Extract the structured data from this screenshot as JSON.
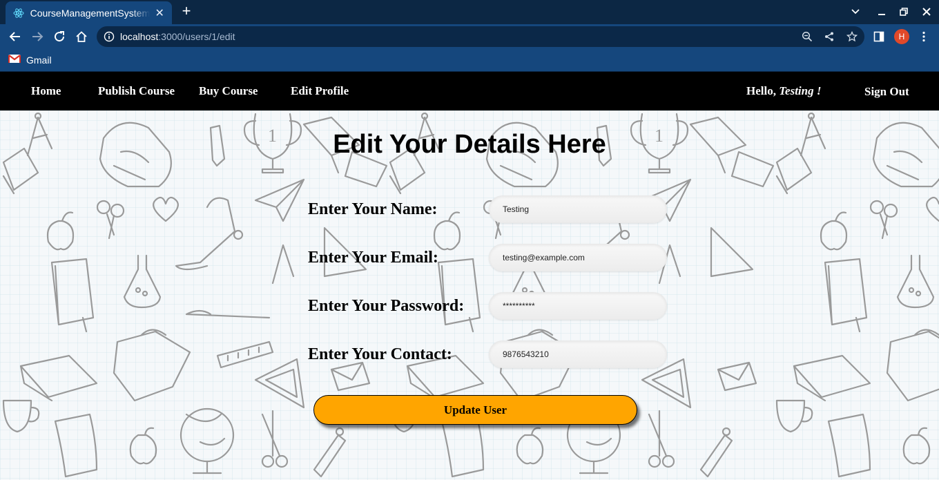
{
  "browser": {
    "tab_title": "CourseManagementSystem",
    "url_host": "localhost",
    "url_path": ":3000/users/1/edit",
    "profile_initial": "H",
    "bookmarks": [
      {
        "label": "Gmail"
      }
    ]
  },
  "nav": {
    "home": "Home",
    "publish": "Publish Course",
    "buy": "Buy Course",
    "edit_profile": "Edit Profile",
    "greeting": "Hello,",
    "username": "Testing !",
    "sign_out": "Sign Out"
  },
  "form": {
    "heading": "Edit Your Details Here",
    "name_label": "Enter Your Name:",
    "name_value": "Testing",
    "email_label": "Enter Your Email:",
    "email_value": "testing@example.com",
    "password_label": "Enter Your Password:",
    "password_placeholder": "**********",
    "contact_label": "Enter Your Contact:",
    "contact_value": "9876543210",
    "submit_label": "Update User"
  },
  "colors": {
    "nav_background": "#000000",
    "button_accent": "#ffa500",
    "browser_chrome": "#15477d"
  }
}
